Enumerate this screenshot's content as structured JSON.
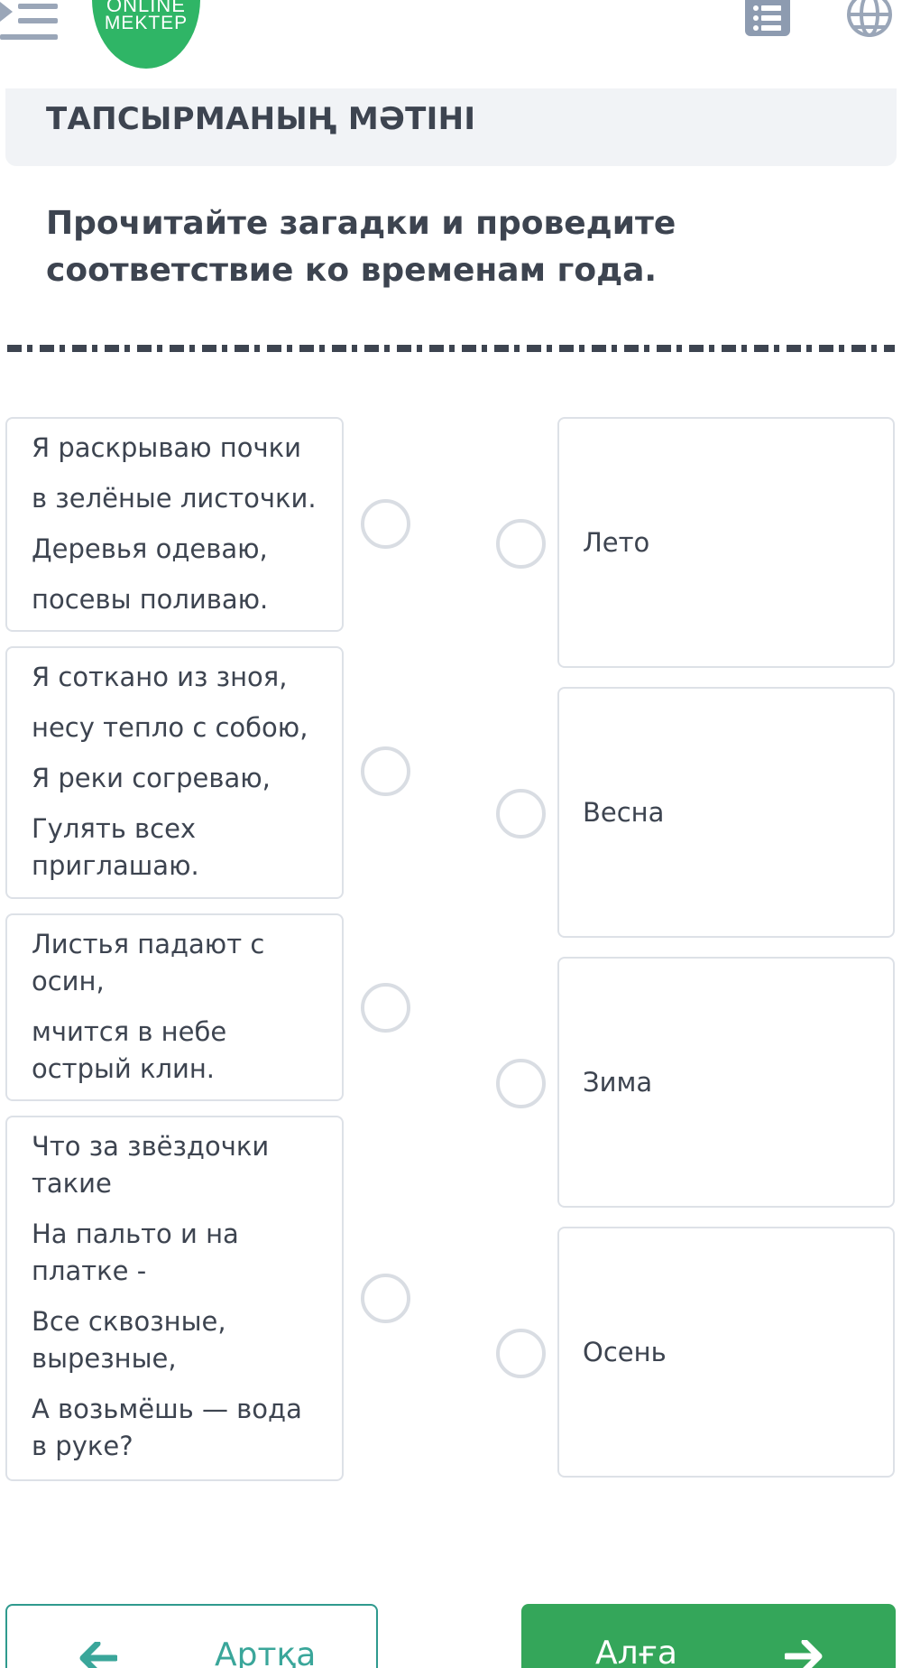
{
  "header": {
    "logo_line1": "ONLINE",
    "logo_line2": "MEKTEP",
    "icons": {
      "menu": "menu-collapse-icon",
      "list": "list-icon",
      "language": "globe-icon"
    }
  },
  "task": {
    "section_title": "ТАПСЫРМАНЫҢ МӘТІНІ",
    "instruction": "Прочитайте загадки и проведите соответствие ко временам года."
  },
  "riddles": [
    {
      "lines": [
        "Я раскрываю почки",
        "в зелёные листочки.",
        "Деревья одеваю,",
        "посевы поливаю."
      ]
    },
    {
      "lines": [
        "Я соткано из зноя,",
        "несу тепло с собою,",
        "Я реки согреваю,",
        "Гулять всех приглашаю."
      ]
    },
    {
      "lines": [
        "Листья падают с осин,",
        "мчится в небе острый клин."
      ]
    },
    {
      "lines": [
        "Что за звёздочки такие",
        "На пальто и на платке -",
        "Все сквозные, вырезные,",
        "А возьмёшь — вода в руке?"
      ]
    }
  ],
  "answers": [
    {
      "label": "Лето"
    },
    {
      "label": "Весна"
    },
    {
      "label": "Зима"
    },
    {
      "label": "Осень"
    }
  ],
  "navigation": {
    "back_label": "Артқа",
    "next_label": "Алға"
  },
  "colors": {
    "brand_green": "#2fb566",
    "next_button": "#34a65a",
    "back_accent": "#3aa69a",
    "text": "#3d4450",
    "card_border": "#dde1e7",
    "radio_border": "#d9dde3",
    "header_bg": "#f1f3f6"
  }
}
